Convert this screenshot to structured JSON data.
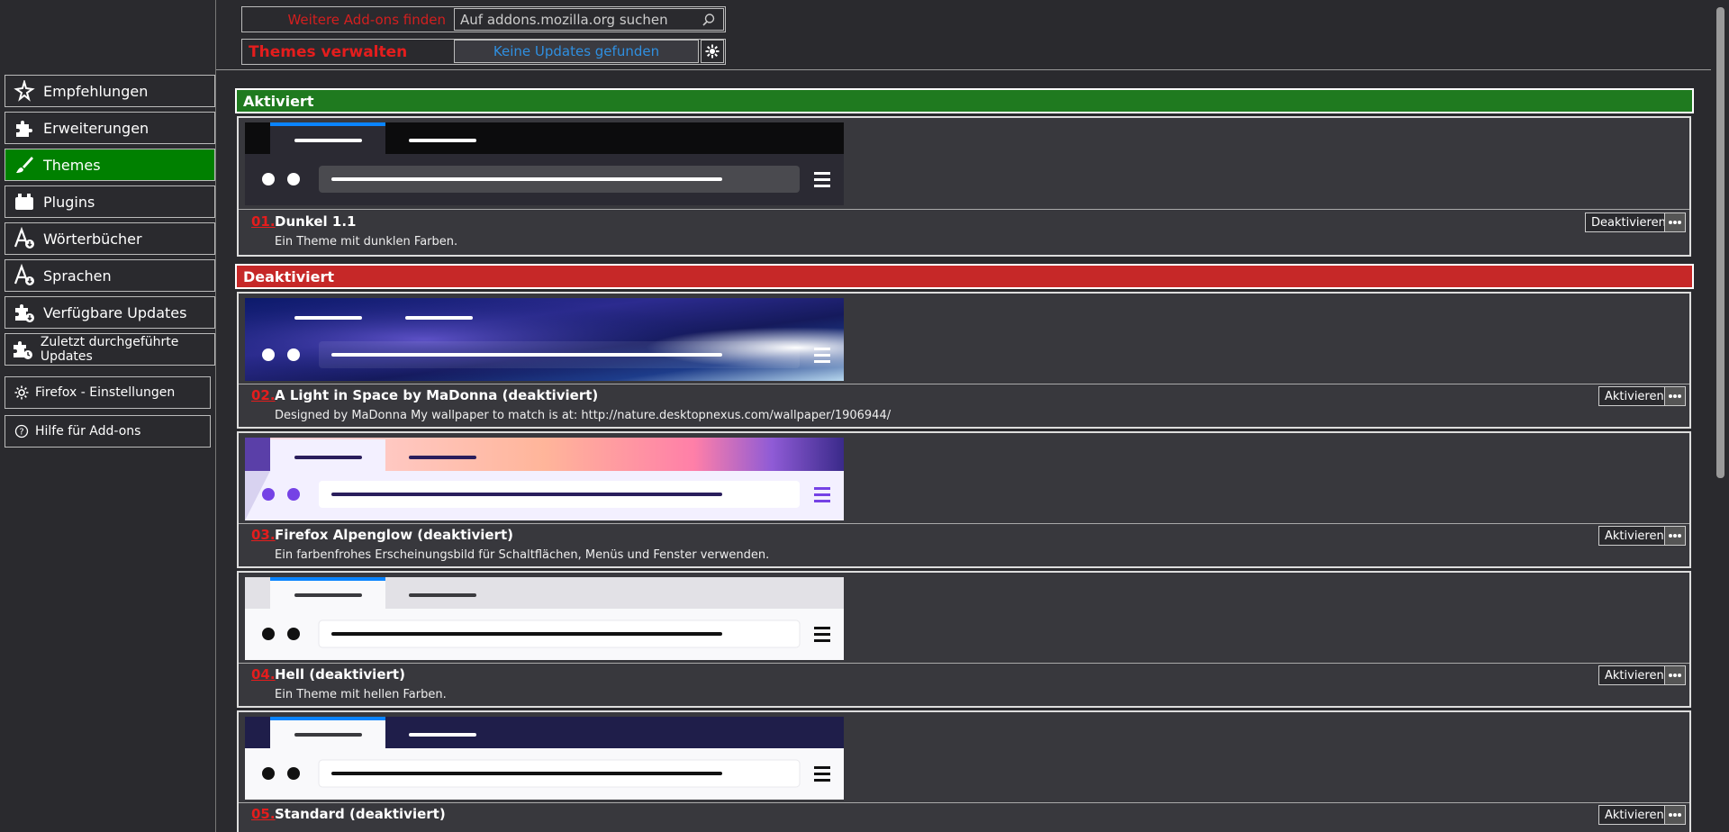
{
  "header": {
    "find_label": "Weitere Add-ons finden",
    "search_placeholder": "Auf addons.mozilla.org suchen",
    "manage_title": "Themes verwalten",
    "updates_label": "Keine Updates gefunden"
  },
  "sidebar": {
    "items": [
      {
        "label": "Empfehlungen",
        "icon": "sparkle-icon"
      },
      {
        "label": "Erweiterungen",
        "icon": "puzzle-icon"
      },
      {
        "label": "Themes",
        "icon": "brush-icon",
        "active": true
      },
      {
        "label": "Plugins",
        "icon": "plugin-icon"
      },
      {
        "label": "Wörterbücher",
        "icon": "dictionary-icon"
      },
      {
        "label": "Sprachen",
        "icon": "language-icon"
      },
      {
        "label": "Verfügbare Updates",
        "icon": "update-icon"
      },
      {
        "label": "Zuletzt durchgeführte Updates",
        "icon": "recent-updates-icon"
      }
    ],
    "footer": [
      {
        "label": "Firefox - Einstellungen",
        "icon": "gear-icon"
      },
      {
        "label": "Hilfe für Add-ons",
        "icon": "help-icon"
      }
    ]
  },
  "sections": {
    "enabled": "Aktiviert",
    "disabled": "Deaktiviert"
  },
  "themes": [
    {
      "num": "01.",
      "name": "Dunkel 1.1",
      "desc": "Ein Theme mit dunklen Farben.",
      "action": "Deaktivieren"
    },
    {
      "num": "02.",
      "name": "A Light in Space by MaDonna (deaktiviert)",
      "desc": "Designed by MaDonna My wallpaper to match is at: http://nature.desktopnexus.com/wallpaper/1906944/",
      "action": "Aktivieren"
    },
    {
      "num": "03.",
      "name": "Firefox Alpenglow (deaktiviert)",
      "desc": "Ein farbenfrohes Erscheinungsbild für Schaltflächen, Menüs und Fenster verwenden.",
      "action": "Aktivieren"
    },
    {
      "num": "04.",
      "name": "Hell (deaktiviert)",
      "desc": "Ein Theme mit hellen Farben.",
      "action": "Aktivieren"
    },
    {
      "num": "05.",
      "name": "Standard (deaktiviert)",
      "desc": "",
      "action": "Aktivieren"
    }
  ],
  "colors": {
    "accent_green": "#1f7a1f",
    "accent_red": "#c62828",
    "link_red": "#e41d1d",
    "update_blue": "#2f8fe0"
  }
}
